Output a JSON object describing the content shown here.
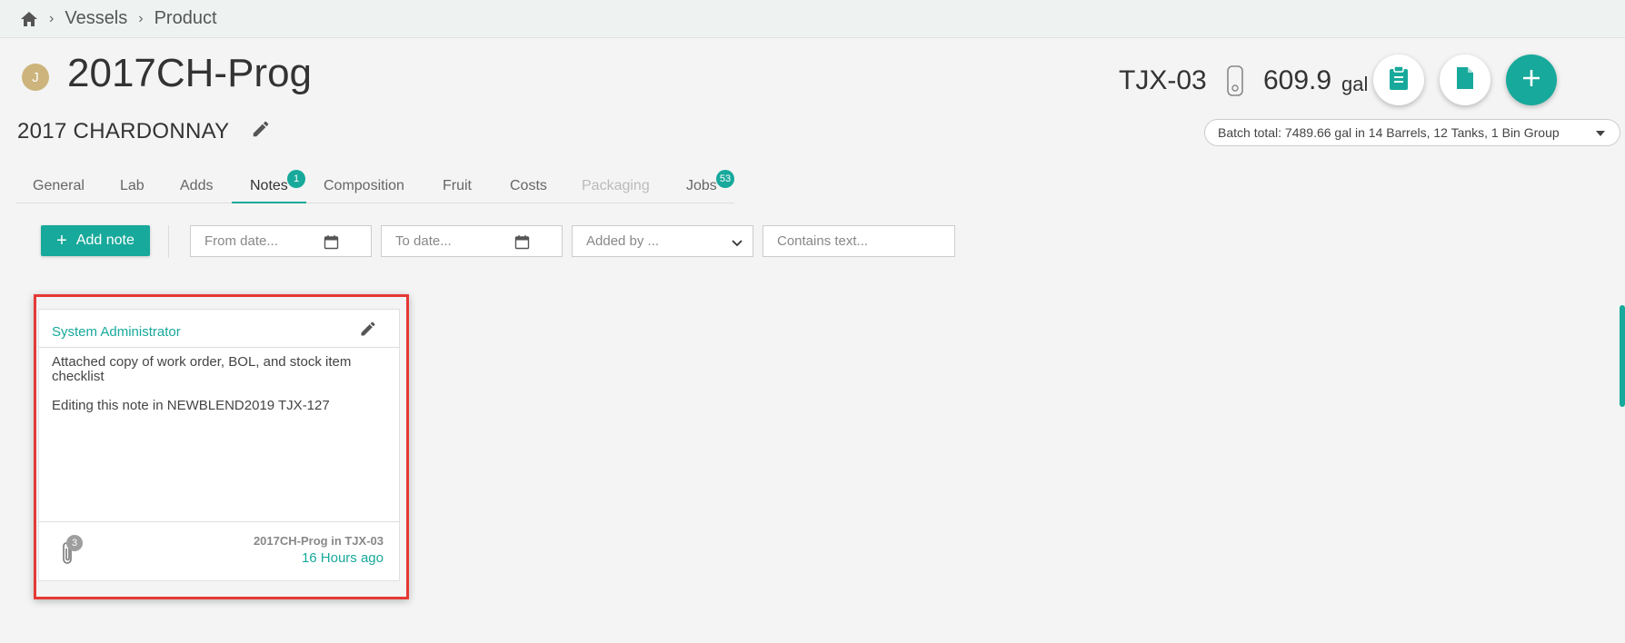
{
  "breadcrumb": {
    "items": [
      "Vessels",
      "Product"
    ],
    "home_icon": "home-icon"
  },
  "lot": {
    "avatar_initial": "J",
    "code": "2017CH-Prog",
    "description": "2017 CHARDONNAY"
  },
  "vessel": {
    "code": "TJX-03",
    "volume": "609.9",
    "unit": "gal"
  },
  "batch_total": "Batch total: 7489.66 gal in 14 Barrels, 12 Tanks, 1 Bin Group",
  "tabs": [
    {
      "label": "General"
    },
    {
      "label": "Lab"
    },
    {
      "label": "Adds"
    },
    {
      "label": "Notes",
      "badge": "1"
    },
    {
      "label": "Composition"
    },
    {
      "label": "Fruit"
    },
    {
      "label": "Costs"
    },
    {
      "label": "Packaging"
    },
    {
      "label": "Jobs",
      "badge": "53"
    }
  ],
  "toolbar": {
    "add_note_label": "Add note",
    "from_date_placeholder": "From date...",
    "to_date_placeholder": "To date...",
    "added_by_placeholder": "Added by ...",
    "contains_text_placeholder": "Contains text..."
  },
  "note": {
    "author": "System Administrator",
    "body_line1": "Attached copy of work order, BOL, and stock item checklist",
    "body_line2": "Editing this note in NEWBLEND2019 TJX-127",
    "attachment_count": "3",
    "location": "2017CH-Prog in TJX-03",
    "time": "16 Hours ago"
  },
  "colors": {
    "accent": "#17a99b",
    "highlight": "#e53935",
    "avatar": "#cdb47c"
  }
}
